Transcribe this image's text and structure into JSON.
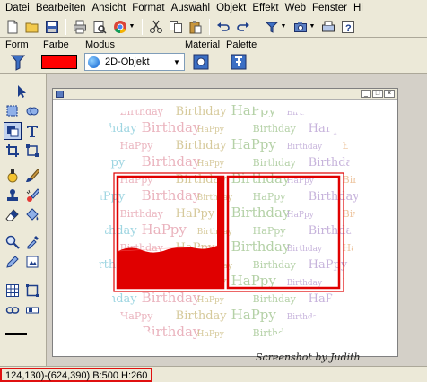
{
  "menu": [
    "Datei",
    "Bearbeiten",
    "Ansicht",
    "Format",
    "Auswahl",
    "Objekt",
    "Effekt",
    "Web",
    "Fenster",
    "Hi"
  ],
  "toolbar": {
    "icons": [
      "new-file-icon",
      "open-folder-icon",
      "save-icon",
      "print-icon",
      "print-preview-icon",
      "browser-icon",
      "cut-icon",
      "copy-icon",
      "paste-icon",
      "undo-icon",
      "redo-icon",
      "palette-dropdown-icon",
      "camera-dropdown-icon",
      "scanner-icon",
      "help-icon"
    ]
  },
  "propbar": {
    "form_label": "Form",
    "color_label": "Farbe",
    "color_value": "#ff0000",
    "mode_label": "Modus",
    "mode_value": "2D-Objekt",
    "material_label": "Material",
    "palette_label": "Palette"
  },
  "tools": [
    "pointer-icon",
    "select-rect-icon",
    "ellipse-select-icon",
    "shape-tool-icon",
    "text-tool-icon",
    "crop-icon",
    "transform-icon",
    "retouch-icon",
    "brush-icon",
    "stamp-icon",
    "paint-brush-icon",
    "eraser-icon",
    "fill-bucket-icon",
    "zoom-icon",
    "eyedropper-icon",
    "pencil-icon",
    "picture-tube-icon",
    "grid-icon",
    "frame-icon",
    "link-icon",
    "scrollbar-icon"
  ],
  "canvas": {
    "background_words": [
      "HaPpy",
      "Birthday",
      "Birthday",
      "HaPpy",
      "Birthday"
    ],
    "accent_color": "#e00000"
  },
  "credit": "Screenshot by Judith",
  "status": {
    "text": "124,130)-(624,390) B:500 H:260"
  }
}
